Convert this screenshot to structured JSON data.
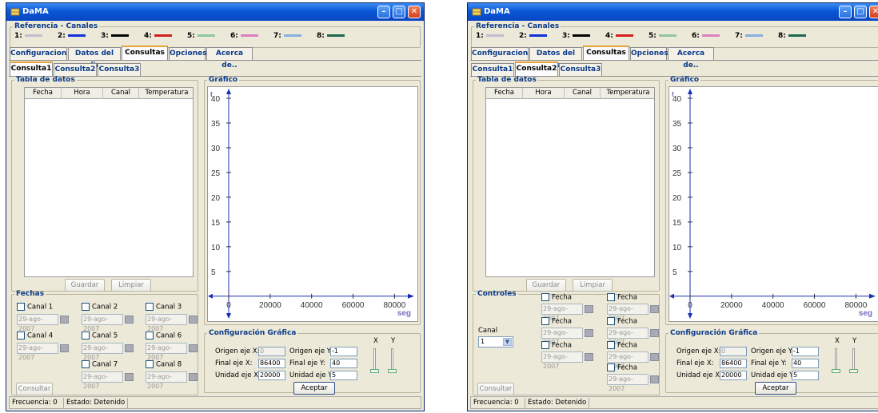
{
  "windows": [
    {
      "title": "DaMA",
      "reference_title": "Referencia - Canales",
      "channels": [
        {
          "label": "1:",
          "color": "#c8b8d0"
        },
        {
          "label": "2:",
          "color": "#1030d8"
        },
        {
          "label": "3:",
          "color": "#000000"
        },
        {
          "label": "4:",
          "color": "#d02020"
        },
        {
          "label": "5:",
          "color": "#90c8a0"
        },
        {
          "label": "6:",
          "color": "#e080c0"
        },
        {
          "label": "7:",
          "color": "#88b0e0"
        },
        {
          "label": "8:",
          "color": "#1e6850"
        }
      ],
      "main_tabs": [
        "Configuracion",
        "Datos del dia",
        "Consultas",
        "Opciones",
        "Acerca de.."
      ],
      "main_tab_selected": "Consultas",
      "sub_tabs": [
        "Consulta1",
        "Consulta2",
        "Consulta3"
      ],
      "sub_tab_selected": "Consulta1",
      "table_title": "Tabla de datos",
      "table_columns": [
        "Fecha",
        "Hora",
        "Canal",
        "Temperatura"
      ],
      "guardar": "Guardar",
      "limpiar": "Limpiar",
      "fechas_title": "Fechas",
      "canales": [
        {
          "label": "Canal 1",
          "date": "29-ago-2007"
        },
        {
          "label": "Canal 2",
          "date": "29-ago-2007"
        },
        {
          "label": "Canal 3",
          "date": "29-ago-2007"
        },
        {
          "label": "Canal 4",
          "date": "29-ago-2007"
        },
        {
          "label": "Canal 5",
          "date": "29-ago-2007"
        },
        {
          "label": "Canal 6",
          "date": "29-ago-2007"
        },
        {
          "label": "Canal 7",
          "date": "29-ago-2007"
        },
        {
          "label": "Canal 8",
          "date": "29-ago-2007"
        }
      ],
      "consultar": "Consultar",
      "grafico_title": "Gráfico",
      "chart_data": {
        "type": "line",
        "ylabel": "t",
        "xlabel": "seg",
        "yticks": [
          5,
          10,
          15,
          20,
          25,
          30,
          35,
          40
        ],
        "xticks": [
          0,
          20000,
          40000,
          60000,
          80000
        ],
        "xlim": [
          0,
          86400
        ],
        "ylim": [
          -1,
          40
        ],
        "series": []
      },
      "config_title": "Configuración Gráfica",
      "config": {
        "origen_x_label": "Origen eje X:",
        "origen_x": "0",
        "final_x_label": "Final eje X:",
        "final_x": "86400",
        "unidad_x_label": "Unidad eje X:",
        "unidad_x": "20000",
        "origen_y_label": "Origen eje Y:",
        "origen_y": "-1",
        "final_y_label": "Final eje Y:",
        "final_y": "40",
        "unidad_y_label": "Unidad eje Y:",
        "unidad_y": "5",
        "x_label": "X",
        "y_label": "Y",
        "aceptar": "Aceptar"
      },
      "status_freq": "Frecuencia: 0",
      "status_estado": "Estado: Detenido"
    },
    {
      "title": "DaMA",
      "reference_title": "Referencia - Canales",
      "channels": [
        {
          "label": "1:",
          "color": "#c8b8d0"
        },
        {
          "label": "2:",
          "color": "#1030d8"
        },
        {
          "label": "3:",
          "color": "#000000"
        },
        {
          "label": "4:",
          "color": "#d02020"
        },
        {
          "label": "5:",
          "color": "#90c8a0"
        },
        {
          "label": "6:",
          "color": "#e080c0"
        },
        {
          "label": "7:",
          "color": "#88b0e0"
        },
        {
          "label": "8:",
          "color": "#1e6850"
        }
      ],
      "main_tabs": [
        "Configuracion",
        "Datos del dia",
        "Consultas",
        "Opciones",
        "Acerca de.."
      ],
      "main_tab_selected": "Consultas",
      "sub_tabs": [
        "Consulta1",
        "Consulta2",
        "Consulta3"
      ],
      "sub_tab_selected": "Consulta2",
      "table_title": "Tabla de datos",
      "table_columns": [
        "Fecha",
        "Hora",
        "Canal",
        "Temperatura"
      ],
      "guardar": "Guardar",
      "limpiar": "Limpiar",
      "controles_title": "Controles",
      "canal_label": "Canal",
      "canal_value": "1",
      "fechas": [
        {
          "label": "Fecha",
          "date": "29-ago-2007"
        },
        {
          "label": "Fecha",
          "date": "29-ago-2007"
        },
        {
          "label": "Fecha",
          "date": "29-ago-2007"
        },
        {
          "label": "Fecha",
          "date": "29-ago-2007"
        },
        {
          "label": "Fecha",
          "date": "29-ago-2007"
        },
        {
          "label": "Fecha",
          "date": "29-ago-2007"
        },
        {
          "label": "Fecha",
          "date": "29-ago-2007"
        }
      ],
      "consultar": "Consultar",
      "grafico_title": "Gráfico",
      "chart_data": {
        "type": "line",
        "ylabel": "t",
        "xlabel": "seg",
        "yticks": [
          5,
          10,
          15,
          20,
          25,
          30,
          35,
          40
        ],
        "xticks": [
          0,
          20000,
          40000,
          60000,
          80000
        ],
        "xlim": [
          0,
          86400
        ],
        "ylim": [
          -1,
          40
        ],
        "series": []
      },
      "config_title": "Configuración Gráfica",
      "config": {
        "origen_x_label": "Origen eje X:",
        "origen_x": "0",
        "final_x_label": "Final eje X:",
        "final_x": "86400",
        "unidad_x_label": "Unidad eje X:",
        "unidad_x": "20000",
        "origen_y_label": "Origen eje Y:",
        "origen_y": "-1",
        "final_y_label": "Final eje Y:",
        "final_y": "40",
        "unidad_y_label": "Unidad eje Y:",
        "unidad_y": "5",
        "x_label": "X",
        "y_label": "Y",
        "aceptar": "Aceptar"
      },
      "status_freq": "Frecuencia: 0",
      "status_estado": "Estado: Detenido"
    }
  ]
}
